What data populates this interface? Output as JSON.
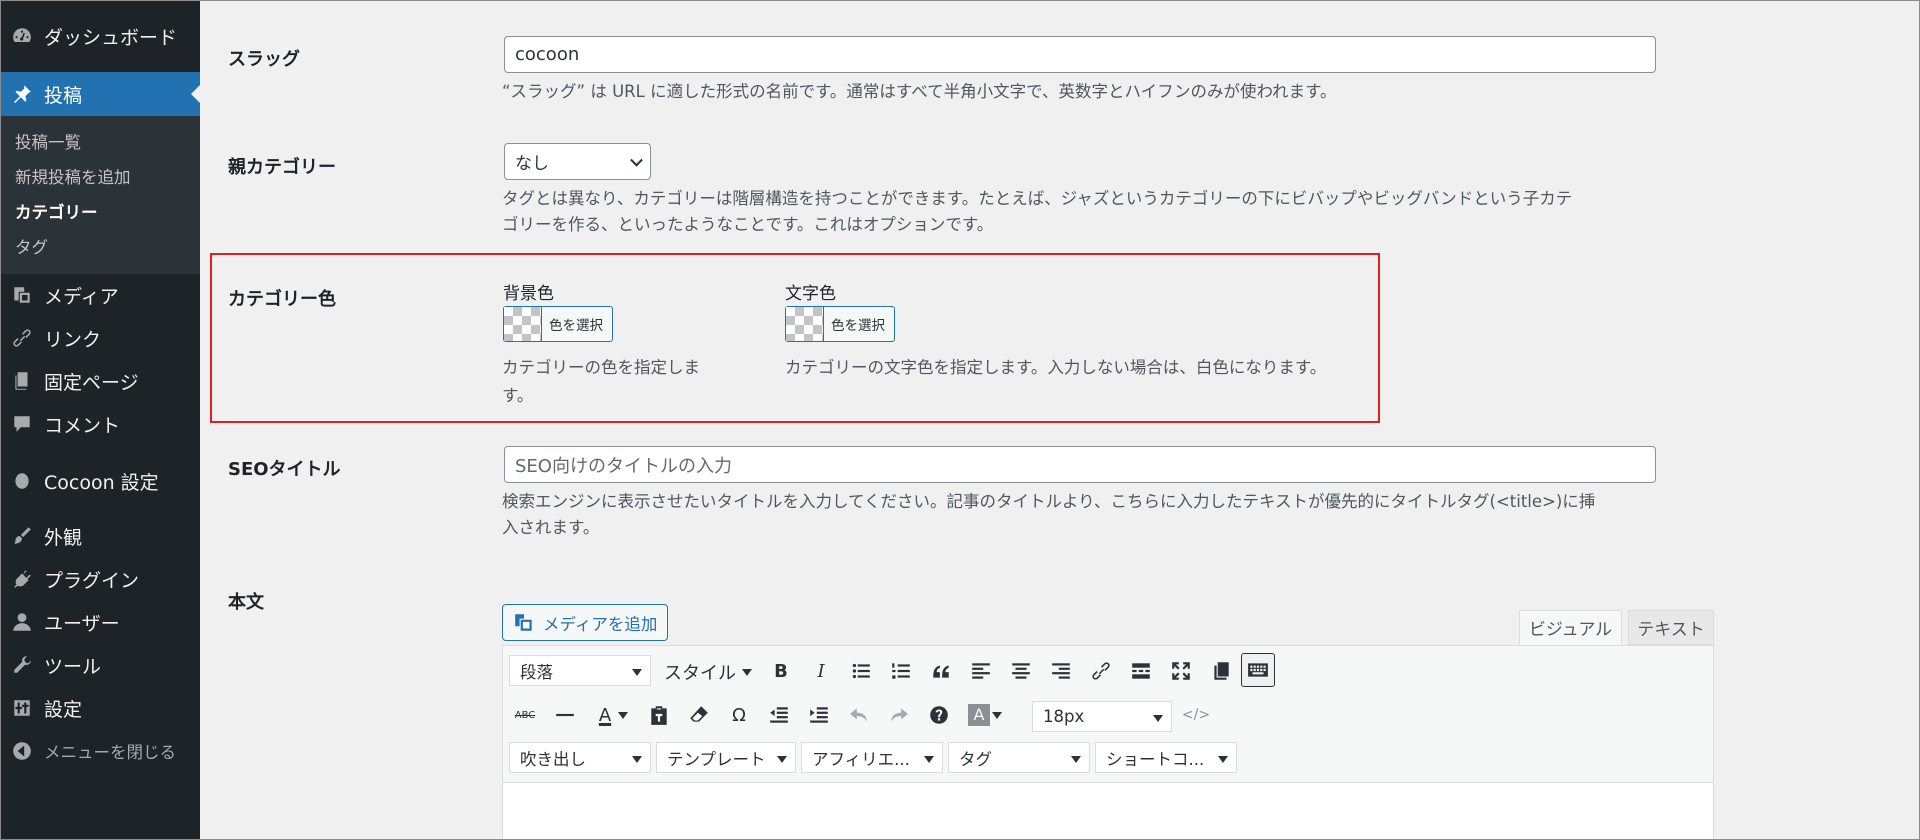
{
  "sidebar": {
    "dashboard": "ダッシュボード",
    "posts": "投稿",
    "sub": [
      "投稿一覧",
      "新規投稿を追加",
      "カテゴリー",
      "タグ"
    ],
    "media": "メディア",
    "links": "リンク",
    "pages": "固定ページ",
    "comments": "コメント",
    "cocoon": "Cocoon 設定",
    "appearance": "外観",
    "plugins": "プラグイン",
    "users": "ユーザー",
    "tools": "ツール",
    "settings": "設定",
    "collapse": "メニューを閉じる"
  },
  "slug": {
    "label": "スラッグ",
    "value": "cocoon",
    "desc": "“スラッグ” は URL に適した形式の名前です。通常はすべて半角小文字で、英数字とハイフンのみが使われます。"
  },
  "parent": {
    "label": "親カテゴリー",
    "value": "なし",
    "desc_line1": "タグとは異なり、カテゴリーは階層構造を持つことができます。たとえば、ジャズというカテゴリーの下にビバップやビッグバンドという子カテ",
    "desc_line2": "ゴリーを作る、といったようなことです。これはオプションです。"
  },
  "category_color": {
    "label": "カテゴリー色",
    "bg_label": "背景色",
    "text_label": "文字色",
    "pick_button": "色を選択",
    "bg_desc_line1": "カテゴリーの色を指定しま",
    "bg_desc_line2": "す。",
    "text_desc": "カテゴリーの文字色を指定します。入力しない場合は、白色になります。",
    "highlight_color": "#e02020"
  },
  "seo": {
    "label": "SEOタイトル",
    "placeholder": "SEO向けのタイトルの入力",
    "desc_line1": "検索エンジンに表示させたいタイトルを入力してください。記事のタイトルより、こちらに入力したテキストが優先的にタイトルタグ(<title>)に挿",
    "desc_line2": "入されます。"
  },
  "body": {
    "label": "本文",
    "add_media": "メディアを追加",
    "tab_visual": "ビジュアル",
    "tab_text": "テキスト",
    "format_select": "段落",
    "style_dropdown": "スタイル",
    "font_size": "18px",
    "balloon": "吹き出し",
    "template": "テンプレート",
    "affiliate": "アフィリエ...",
    "tag": "タグ",
    "shortcode": "ショートコ..."
  },
  "colors": {
    "sidebar_bg": "#1d2327",
    "accent": "#2271b1",
    "page_bg": "#f0f0f1"
  }
}
